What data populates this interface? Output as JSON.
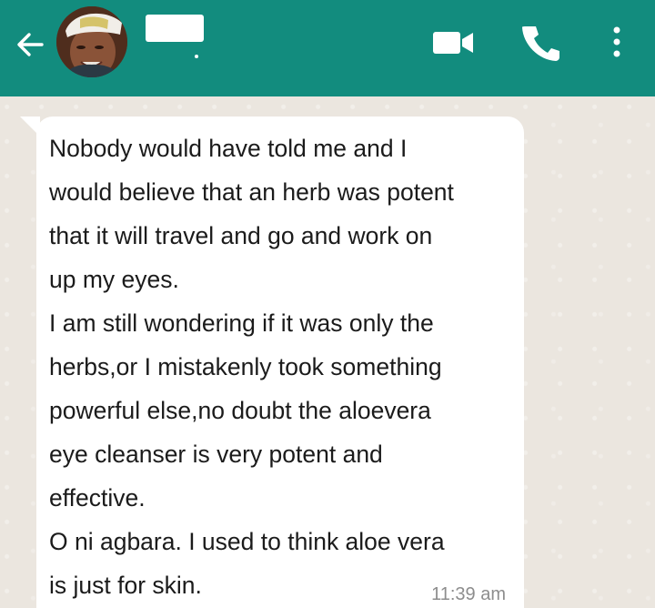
{
  "header": {
    "contact_name": "",
    "status": "",
    "background_color": "#128c7e",
    "icons": {
      "back": "back-arrow-icon",
      "video": "video-call-icon",
      "call": "phone-icon",
      "menu": "more-vertical-icon"
    }
  },
  "chat": {
    "message": {
      "text": " Nobody would have told me and I\nwould believe that an herb was potent\nthat it will travel and go and work on\nup my eyes.\nI am still wondering if it was only the\nherbs,or I mistakenly took something\npowerful else,no doubt the aloevera\neye cleanser is very potent and\neffective.\nO ni agbara. I used to think aloe vera\nis just for skin.",
      "time": "11:39 am",
      "bubble_color": "#ffffff"
    },
    "background_color": "#ebe6df"
  }
}
